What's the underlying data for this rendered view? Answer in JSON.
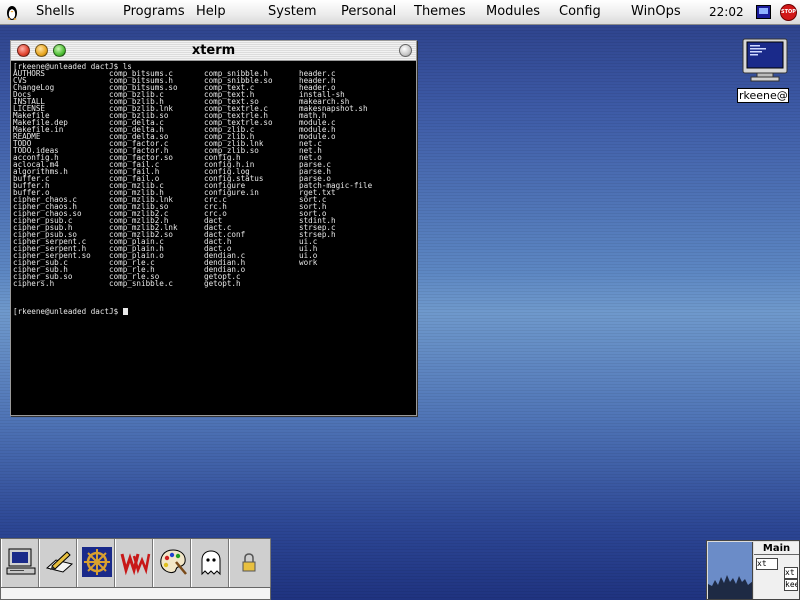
{
  "menubar": {
    "items": [
      "Shells",
      "Programs",
      "Help",
      "System",
      "Personal",
      "Themes",
      "Modules",
      "Config",
      "WinOps"
    ],
    "clock": "22:02",
    "stop_label": "STOP"
  },
  "xterm": {
    "title": "xterm",
    "prompt": "[rkeene@unleaded dactJ$ ls",
    "prompt_end": "[rkeene@unleaded dactJ$ ",
    "columns": [
      [
        "AUTHORS",
        "CVS",
        "ChangeLog",
        "Docs",
        "INSTALL",
        "LICENSE",
        "Makefile",
        "Makefile.dep",
        "Makefile.in",
        "README",
        "TODO",
        "TODO.ideas",
        "acconfig.h",
        "aclocal.m4",
        "algorithms.h",
        "buffer.c",
        "buffer.h",
        "buffer.o",
        "cipher_chaos.c",
        "cipher_chaos.h",
        "cipher_chaos.so",
        "cipher_psub.c",
        "cipher_psub.h",
        "cipher_psub.so",
        "cipher_serpent.c",
        "cipher_serpent.h",
        "cipher_serpent.so",
        "cipher_sub.c",
        "cipher_sub.h",
        "cipher_sub.so",
        "ciphers.h"
      ],
      [
        "comp_bitsums.c",
        "comp_bitsums.h",
        "comp_bitsums.so",
        "comp_bzlib.c",
        "comp_bzlib.h",
        "comp_bzlib.lnk",
        "comp_bzlib.so",
        "comp_delta.c",
        "comp_delta.h",
        "comp_delta.so",
        "comp_factor.c",
        "comp_factor.h",
        "comp_factor.so",
        "comp_fail.c",
        "comp_fail.h",
        "comp_fail.o",
        "comp_mzlib.c",
        "comp_mzlib.h",
        "comp_mzlib.lnk",
        "comp_mzlib.so",
        "comp_mzlib2.c",
        "comp_mzlib2.h",
        "comp_mzlib2.lnk",
        "comp_mzlib2.so",
        "comp_plain.c",
        "comp_plain.h",
        "comp_plain.o",
        "comp_rle.c",
        "comp_rle.h",
        "comp_rle.so",
        "comp_snibble.c"
      ],
      [
        "comp_snibble.h",
        "comp_snibble.so",
        "comp_text.c",
        "comp_text.h",
        "comp_text.so",
        "comp_textrle.c",
        "comp_textrle.h",
        "comp_textrle.so",
        "comp_zlib.c",
        "comp_zlib.h",
        "comp_zlib.lnk",
        "comp_zlib.so",
        "config.h",
        "config.h.in",
        "config.log",
        "config.status",
        "configure",
        "configure.in",
        "crc.c",
        "crc.h",
        "crc.o",
        "dact",
        "dact.c",
        "dact.conf",
        "dact.h",
        "dact.o",
        "dendian.c",
        "dendian.h",
        "dendian.o",
        "getopt.c",
        "getopt.h"
      ],
      [
        "header.c",
        "header.h",
        "header.o",
        "install-sh",
        "makearch.sh",
        "makesnapshot.sh",
        "math.h",
        "module.c",
        "module.h",
        "module.o",
        "net.c",
        "net.h",
        "net.o",
        "parse.c",
        "parse.h",
        "parse.o",
        "patch-magic-file",
        "rget.txt",
        "sort.c",
        "sort.h",
        "sort.o",
        "stdint.h",
        "strsep.c",
        "strsep.h",
        "ui.c",
        "ui.h",
        "ui.o",
        "work"
      ]
    ]
  },
  "desktop_icon": {
    "label": "rkeene@n"
  },
  "launcher": {
    "buttons": [
      "computer-icon",
      "text-editor-icon",
      "netscape-helm-icon",
      "word-processor-icon",
      "paint-palette-icon",
      "ghost-icon",
      "lock-icon"
    ]
  },
  "pager": {
    "title": "Main",
    "mini1": "xt",
    "mini2": "xt",
    "mini3": "keen"
  },
  "colors": {
    "terminal_bg": "#000000",
    "terminal_fg": "#e8e8e8",
    "menubar_bg": "#ececec",
    "desktop_blue": "#4f74b6"
  }
}
